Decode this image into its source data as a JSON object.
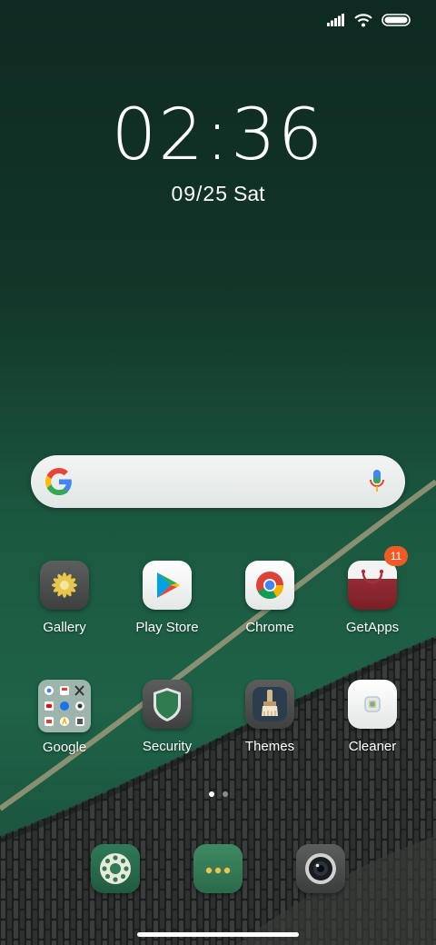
{
  "status_bar": {
    "signal_icon": "signal-icon",
    "wifi_icon": "wifi-icon",
    "battery_icon": "battery-icon"
  },
  "clock": {
    "time": "02:36",
    "date": "09/25",
    "weekday": "Sat"
  },
  "search": {
    "logo": "google-g-icon",
    "mic": "mic-icon"
  },
  "apps_row1": [
    {
      "label": "Gallery"
    },
    {
      "label": "Play Store"
    },
    {
      "label": "Chrome"
    },
    {
      "label": "GetApps",
      "badge": "11"
    }
  ],
  "apps_row2": [
    {
      "label": "Google"
    },
    {
      "label": "Security"
    },
    {
      "label": "Themes"
    },
    {
      "label": "Cleaner"
    }
  ],
  "page_indicator": {
    "pages": 2,
    "current": 1
  },
  "dock": [
    {
      "name": "phone-icon"
    },
    {
      "name": "messages-icon"
    },
    {
      "name": "camera-icon"
    }
  ]
}
